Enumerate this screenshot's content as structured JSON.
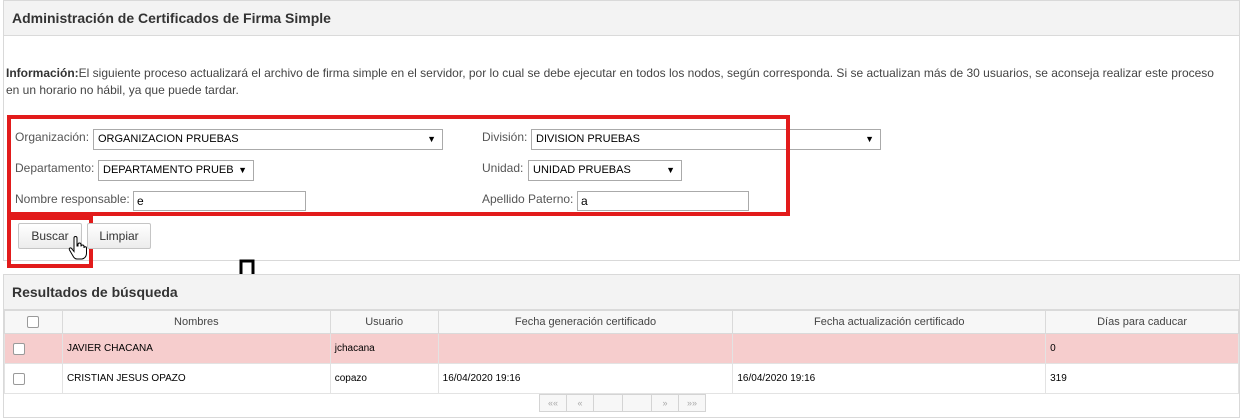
{
  "page": {
    "title": "Administración de Certificados de Firma Simple",
    "info_label": "Información:",
    "info_text": "El siguiente proceso actualizará el archivo de firma simple en el servidor, por lo cual se debe ejecutar en todos los nodos, según corresponda. Si se actualizan más de 30 usuarios, se aconseja realizar este proceso en un horario no hábil, ya que puede tardar."
  },
  "form": {
    "organizacion_label": "Organización:",
    "organizacion_value": "ORGANIZACION PRUEBAS",
    "division_label": "División:",
    "division_value": "DIVISION PRUEBAS",
    "departamento_label": "Departamento:",
    "departamento_value": "DEPARTAMENTO PRUEB",
    "unidad_label": "Unidad:",
    "unidad_value": "UNIDAD PRUEBAS",
    "nombre_label": "Nombre responsable:",
    "nombre_value": "e",
    "apellido_label": "Apellido Paterno:",
    "apellido_value": "a",
    "buscar_label": "Buscar",
    "limpiar_label": "Limpiar",
    "dropdown_glyph": "▼"
  },
  "results": {
    "title": "Resultados de búsqueda",
    "columns": [
      "Nombres",
      "Usuario",
      "Fecha generación certificado",
      "Fecha actualización certificado",
      "Días para caducar"
    ],
    "rows": [
      {
        "nombres": "JAVIER CHACANA",
        "usuario": "jchacana",
        "fecha_gen": "",
        "fecha_act": "",
        "dias": "0",
        "highlight": true
      },
      {
        "nombres": "CRISTIAN JESUS OPAZO",
        "usuario": "copazo",
        "fecha_gen": "16/04/2020 19:16",
        "fecha_act": "16/04/2020 19:16",
        "dias": "319",
        "highlight": false
      }
    ]
  },
  "pager": {
    "first": "««",
    "prev": "«",
    "next": "»",
    "last": "»»"
  },
  "colors": {
    "highlight_box": "#e21b1b",
    "row_highlight": "#f6cdcd"
  },
  "icons": {
    "cursor": "hand-pointer-icon",
    "arrow": "down-arrow-icon"
  }
}
